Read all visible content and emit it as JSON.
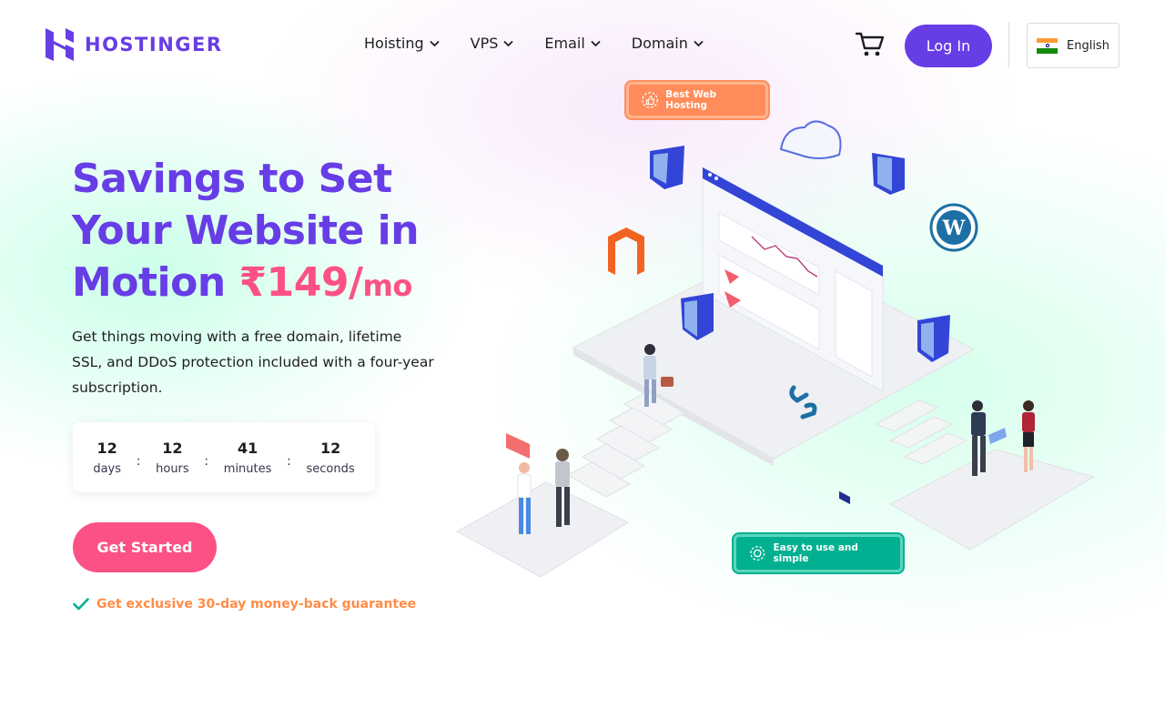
{
  "brand": {
    "name": "HOSTINGER",
    "color": "#673de6"
  },
  "nav": {
    "items": [
      {
        "label": "Hoisting"
      },
      {
        "label": "VPS"
      },
      {
        "label": "Email"
      },
      {
        "label": "Domain"
      }
    ]
  },
  "header": {
    "login_label": "Log In",
    "language": "English",
    "cart_icon": "shopping-cart-icon"
  },
  "hero": {
    "title": "Savings to Set Your Website in Motion",
    "price": "₹149/",
    "price_unit": "mo",
    "subtitle": "Get things moving with a free domain, lifetime SSL, and DDoS protection included with a four-year subscription.",
    "cta_label": "Get Started",
    "guarantee": "Get exclusive 30-day money-back guarantee"
  },
  "countdown": {
    "separator": ":",
    "units": [
      {
        "value": "12",
        "label": "days"
      },
      {
        "value": "12",
        "label": "hours"
      },
      {
        "value": "41",
        "label": "minutes"
      },
      {
        "value": "12",
        "label": "seconds"
      }
    ]
  },
  "illustration": {
    "badge_top": "Best Web Hosting",
    "badge_bottom": "Easy to use and simple"
  },
  "colors": {
    "accent": "#673de6",
    "pink": "#fc5185",
    "orange": "#ff8c47",
    "green": "#00b090"
  }
}
